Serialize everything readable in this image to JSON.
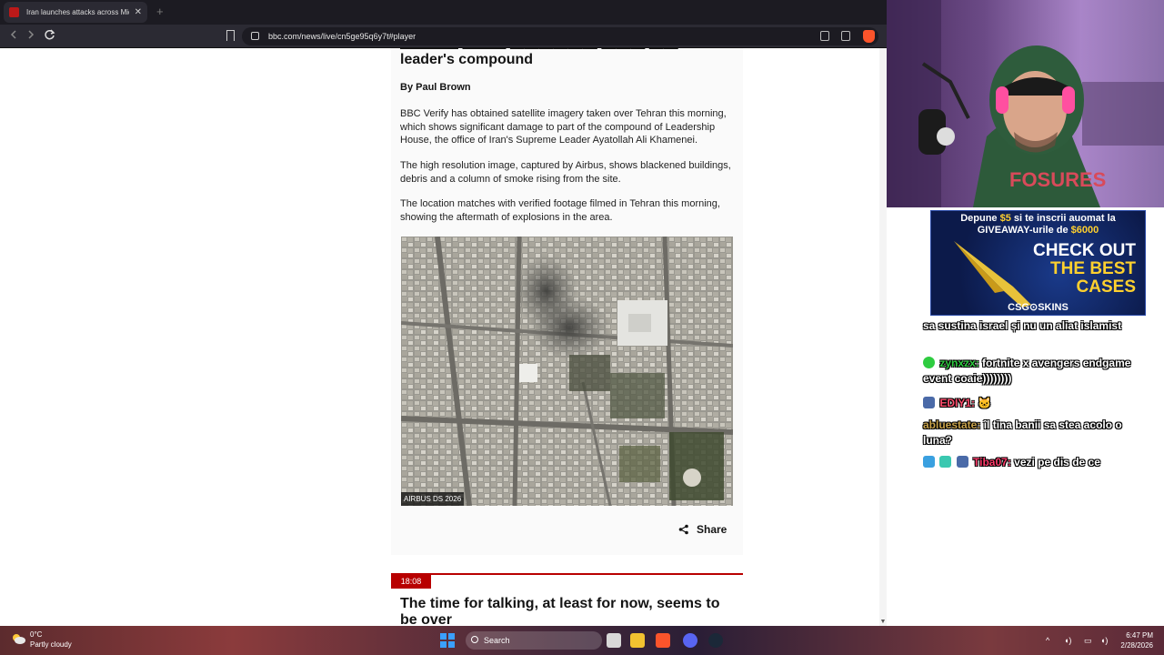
{
  "browser": {
    "tab_title": "Iran launches attacks across Mid",
    "tab_close": "✕",
    "new_tab": "+",
    "url": "bbc.com/news/live/cn5ge95q6y7t#player"
  },
  "article": {
    "headline_tail": "leader's compound",
    "byline": "By Paul Brown",
    "paragraphs": [
      "BBC Verify has obtained satellite imagery taken over Tehran this morning, which shows significant damage to part of the compound of Leadership House, the office of Iran's Supreme Leader Ayatollah Ali Khamenei.",
      "The high resolution image, captured by Airbus, shows blackened buildings, debris and a column of smoke rising from the site.",
      "The location matches with verified footage filmed in Tehran this morning, showing the aftermath of explosions in the area."
    ],
    "image_caption": "AIRBUS DS 2026",
    "share_label": "Share",
    "next_time": "18:08",
    "next_headline": "The time for talking, at least for now, seems to be over"
  },
  "stream": {
    "ad": {
      "line1_a": "Depune ",
      "line1_amount": "$5",
      "line1_b": " si te inscrii auomat la",
      "line2_a": "GIVEAWAY-urile de ",
      "line2_amount": "$6000",
      "big1": "CHECK OUT",
      "big2": "THE BEST",
      "big3": "CASES",
      "brand": "CSG⊙SKINS"
    },
    "chat": [
      {
        "user": "",
        "user_color": "#ffffff",
        "text": "sa sustina israel și nu un aliat islamist"
      },
      {
        "user": "zynxzx:",
        "user_color": "#2ecc40",
        "text": " fortnite x avengers endgame event coaie))))))))"
      },
      {
        "user": "EDIY1:",
        "user_color": "#ff4d6d",
        "text": " 🐱"
      },
      {
        "user": "abluestate:",
        "user_color": "#c8a24a",
        "text": " îl tina banii sa stea acolo o luna?"
      },
      {
        "user": "Tiba07:",
        "user_color": "#ff3b6b",
        "text": " vezi pe dis de ce"
      }
    ]
  },
  "taskbar": {
    "temp": "0°C",
    "weather": "Partly cloudy",
    "search": "Search",
    "time": "6:47 PM",
    "date": "2/28/2026"
  }
}
